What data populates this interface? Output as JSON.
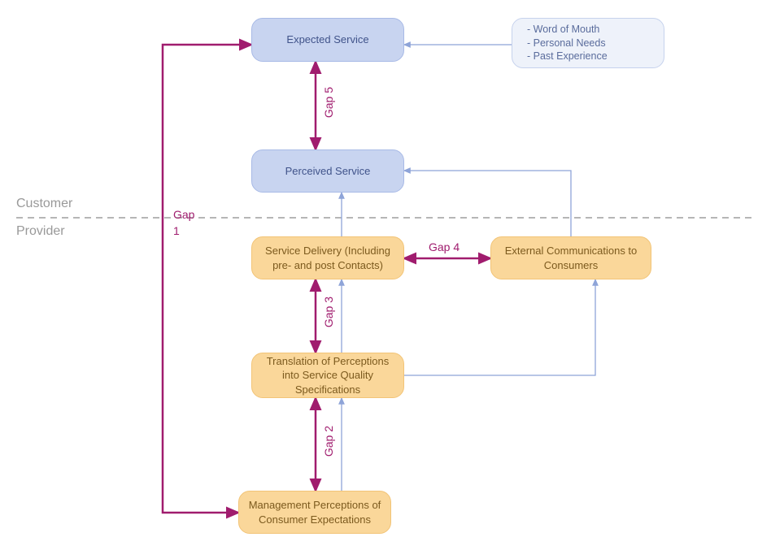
{
  "zones": {
    "customer": "Customer",
    "provider": "Provider"
  },
  "nodes": {
    "expected": "Expected Service",
    "influences": {
      "line1": "- Word of Mouth",
      "line2": "- Personal Needs",
      "line3": "- Past Experience"
    },
    "perceived": "Perceived Service",
    "delivery": "Service Delivery (Including pre- and post Contacts)",
    "external": "External Communications to Consumers",
    "translation": "Translation of Perceptions into Service Quality Specifications",
    "mgmt": "Management Perceptions of Consumer Expectations"
  },
  "gaps": {
    "g1a": "Gap",
    "g1b": "1",
    "g2": "Gap 2",
    "g3": "Gap 3",
    "g4": "Gap 4",
    "g5": "Gap 5"
  },
  "colors": {
    "gap": "#a01c6e",
    "flow": "#8ea4d8"
  }
}
